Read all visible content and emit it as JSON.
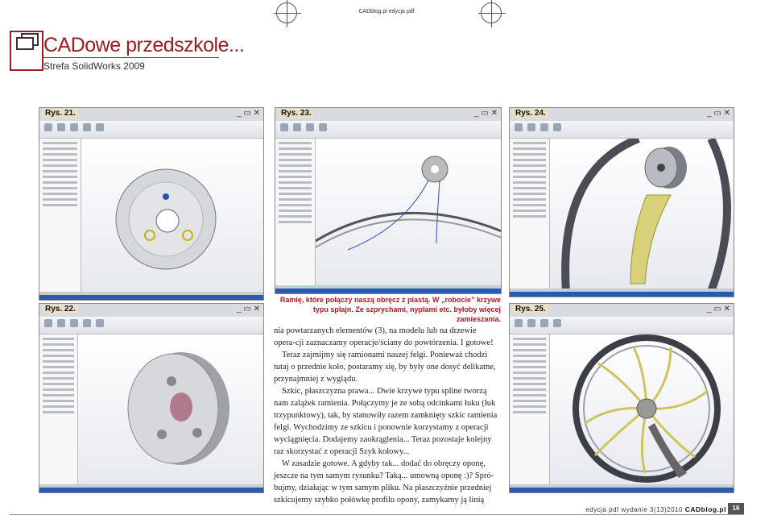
{
  "header": {
    "url": "CADblog.pl edycja pdf",
    "logo_title": "CADowe przedszkole...",
    "logo_subtitle": "Strefa SolidWorks 2009"
  },
  "figures": {
    "fig21": "Rys. 21.",
    "fig22": "Rys. 22.",
    "fig23": "Rys. 23.",
    "fig24": "Rys. 24.",
    "fig25": "Rys. 25."
  },
  "caption": {
    "line1": "Ramię, które połączy naszą obręcz z piastą. W „robocie” krzywe",
    "line2": "typu splajn. Ze szprychami, nyplami etc. byłoby więcej zamieszania."
  },
  "article": {
    "p1": "nia powtarzanych elementów (3), na modelu lub na drzewie opera-cji zaznaczamy operacje/ściany do powtórzenia. I gotowe!",
    "p2": "Teraz zajmijmy się ramionami naszej felgi. Ponieważ chodzi tutaj o przednie koło, postaramy się, by były one dosyć delikatne, przynajmniej z wyglądu.",
    "p3": "Szkic, płaszczyzna prawa... Dwie krzywe typu spline tworzą nam zalążek ramienia. Połączymy je ze sobą odcinkami łuku (łuk trzypunktowy), tak, by stanowiły razem zamknięty szkic ramienia felgi. Wychodzimy ze szkicu i ponownie korzystamy z operacji wyciągnięcia. Dodajemy zaokrąglenia... Teraz pozostaje kolejny raz skorzystać z operacji Szyk kołowy...",
    "p4": "W zasadzie gotowe. A gdyby tak... dodać do obręczy oponę, jeszcze na tym samym rysunku? Taką... umowną oponę :)? Spró-bujmy, działając w tym samym pliku. Na płaszczyźnie przedniej szkicujemy szybko połówkę profilu opony, zamykamy ją linią"
  },
  "window_controls": "_ ▭ ✕",
  "footer": {
    "text": "edycja pdf wydanie 3(13)2010",
    "brand": "CADblog.pl",
    "page": "16"
  }
}
